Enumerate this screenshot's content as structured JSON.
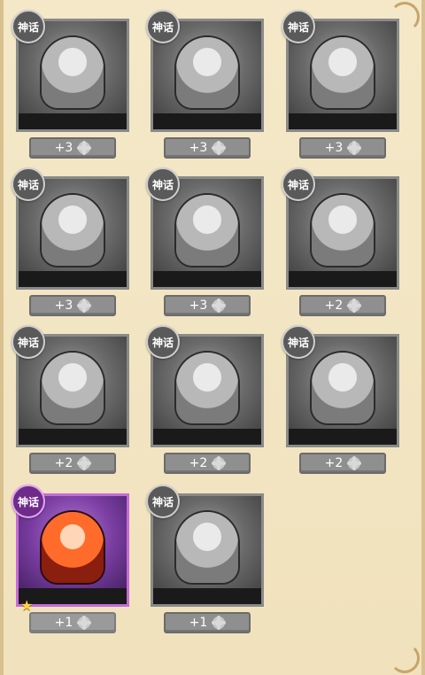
{
  "badge_label": "神话",
  "cards": [
    {
      "count": "+3"
    },
    {
      "count": "+3"
    },
    {
      "count": "+3"
    },
    {
      "count": "+3"
    },
    {
      "count": "+3"
    },
    {
      "count": "+2"
    },
    {
      "count": "+2"
    },
    {
      "count": "+2"
    },
    {
      "count": "+2"
    },
    {
      "count": "+1",
      "active": true,
      "star": "★"
    },
    {
      "count": "+1"
    }
  ]
}
